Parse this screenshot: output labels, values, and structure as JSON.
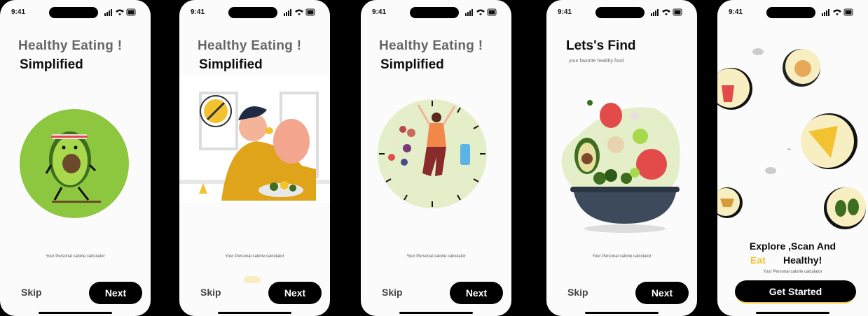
{
  "status_time": "9:41",
  "screens": [
    {
      "title": "Healthy Eating !",
      "subtitle": "Simplified",
      "tagline": "Your Personal calorie calculator",
      "skip": "Skip",
      "next": "Next"
    },
    {
      "title": "Healthy Eating !",
      "subtitle": "Simplified",
      "tagline": "Your Personal calorie calculator",
      "skip": "Skip",
      "next": "Next"
    },
    {
      "title": "Healthy Eating !",
      "subtitle": "Simplified",
      "tagline": "Your Personal calorie calculator",
      "skip": "Skip",
      "next": "Next"
    },
    {
      "title": "Lets's Find",
      "subtitle": "your favorite healthy food",
      "tagline": "Your Personal calorie calculator",
      "skip": "Skip",
      "next": "Next"
    },
    {
      "headline_line1": "Explore ,Scan And",
      "headline_eat": "Eat",
      "headline_rest": "Healthy!",
      "tagline": "Your Personal calorie calculator",
      "cta": "Get Started"
    }
  ],
  "colors": {
    "accent_yellow": "#f2c230",
    "avocado_green": "#8dc63f",
    "mint": "#e4efc9",
    "button_black": "#000000"
  }
}
